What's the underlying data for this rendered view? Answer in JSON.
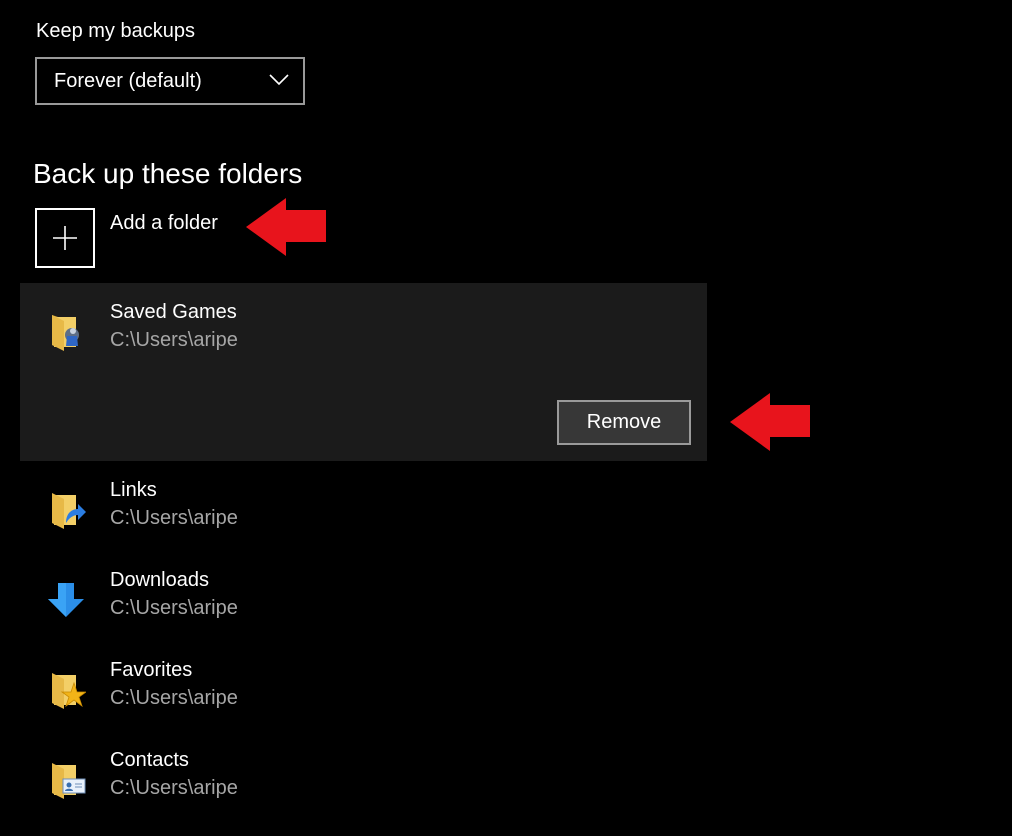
{
  "backups": {
    "label": "Keep my backups",
    "selected": "Forever (default)"
  },
  "folders_section": {
    "title": "Back up these folders",
    "add_label": "Add a folder",
    "remove_label": "Remove",
    "items": [
      {
        "name": "Saved Games",
        "path": "C:\\Users\\aripe",
        "icon": "saved-games-folder-icon"
      },
      {
        "name": "Links",
        "path": "C:\\Users\\aripe",
        "icon": "links-folder-icon"
      },
      {
        "name": "Downloads",
        "path": "C:\\Users\\aripe",
        "icon": "download-arrow-icon"
      },
      {
        "name": "Favorites",
        "path": "C:\\Users\\aripe",
        "icon": "favorites-folder-icon"
      },
      {
        "name": "Contacts",
        "path": "C:\\Users\\aripe",
        "icon": "contacts-folder-icon"
      }
    ]
  },
  "colors": {
    "background": "#000000",
    "selected_item_bg": "#1b1b1b",
    "secondary_text": "#a6a6a6",
    "annotation_arrow": "#e8141c"
  }
}
